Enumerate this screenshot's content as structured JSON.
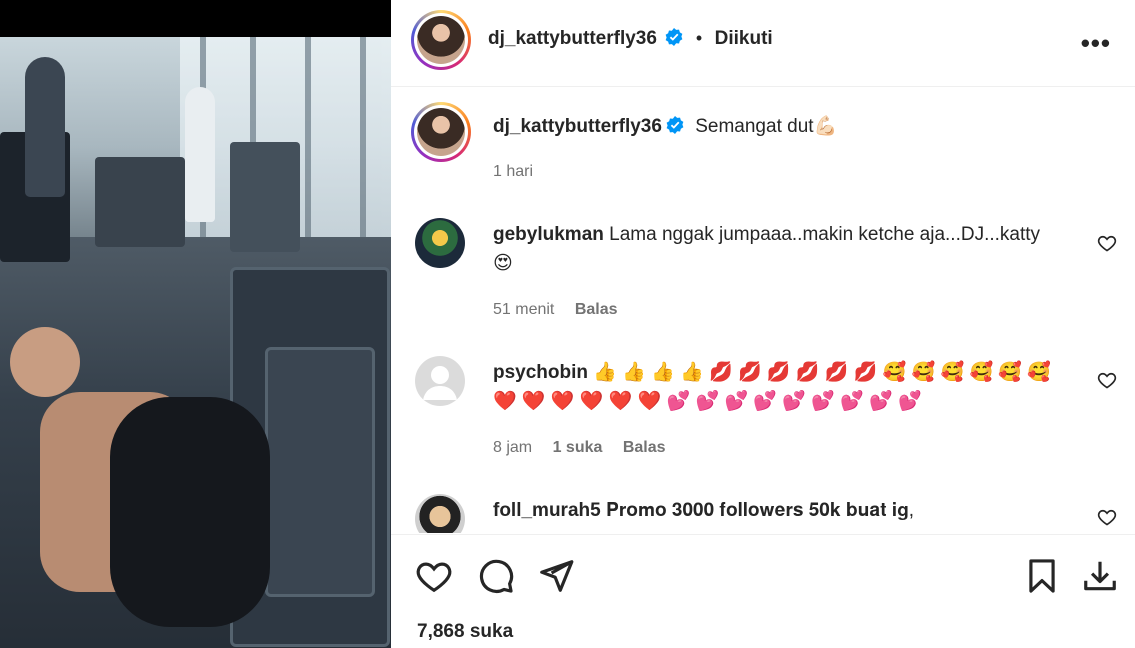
{
  "header": {
    "username": "dj_kattybutterfly36",
    "dot": "•",
    "follow_status": "Diikuti",
    "more_label": "•••"
  },
  "caption": {
    "username": "dj_kattybutterfly36",
    "text": "Semangat dut💪🏻",
    "time": "1 hari"
  },
  "comments": [
    {
      "username": "gebylukman",
      "text": "Lama nggak jumpaaa..makin ketche aja...DJ...katty",
      "text_line2": "😍",
      "time": "51 menit",
      "reply": "Balas"
    },
    {
      "username": "psychobin",
      "text": "👍 👍 👍 👍 💋 💋 💋 💋 💋 💋 🥰 🥰 🥰 🥰 🥰 🥰",
      "text_line2": "❤️ ❤️ ❤️ ❤️ ❤️ ❤️ 💕 💕 💕 💕 💕 💕 💕 💕 💕",
      "time": "8 jam",
      "likes": "1 suka",
      "reply": "Balas"
    },
    {
      "username": "foll_murah5",
      "text": "𝐏𝐫𝐨𝐦𝐨 𝟑𝟎𝟎𝟎 𝐟𝐨𝐥𝐥𝐨𝐰𝐞𝐫𝐬 𝟓𝟎𝐤 𝐛𝐮𝐚𝐭 𝐢𝐠,"
    }
  ],
  "footer": {
    "likes": "7,868 suka"
  },
  "icons": {
    "verified": "verified-badge-icon",
    "like": "heart-icon",
    "comment": "comment-icon",
    "share": "paper-plane-icon",
    "save": "bookmark-icon",
    "download": "download-icon"
  },
  "colors": {
    "verified": "#0095f6",
    "meta_text": "#737373",
    "text": "#262626"
  }
}
